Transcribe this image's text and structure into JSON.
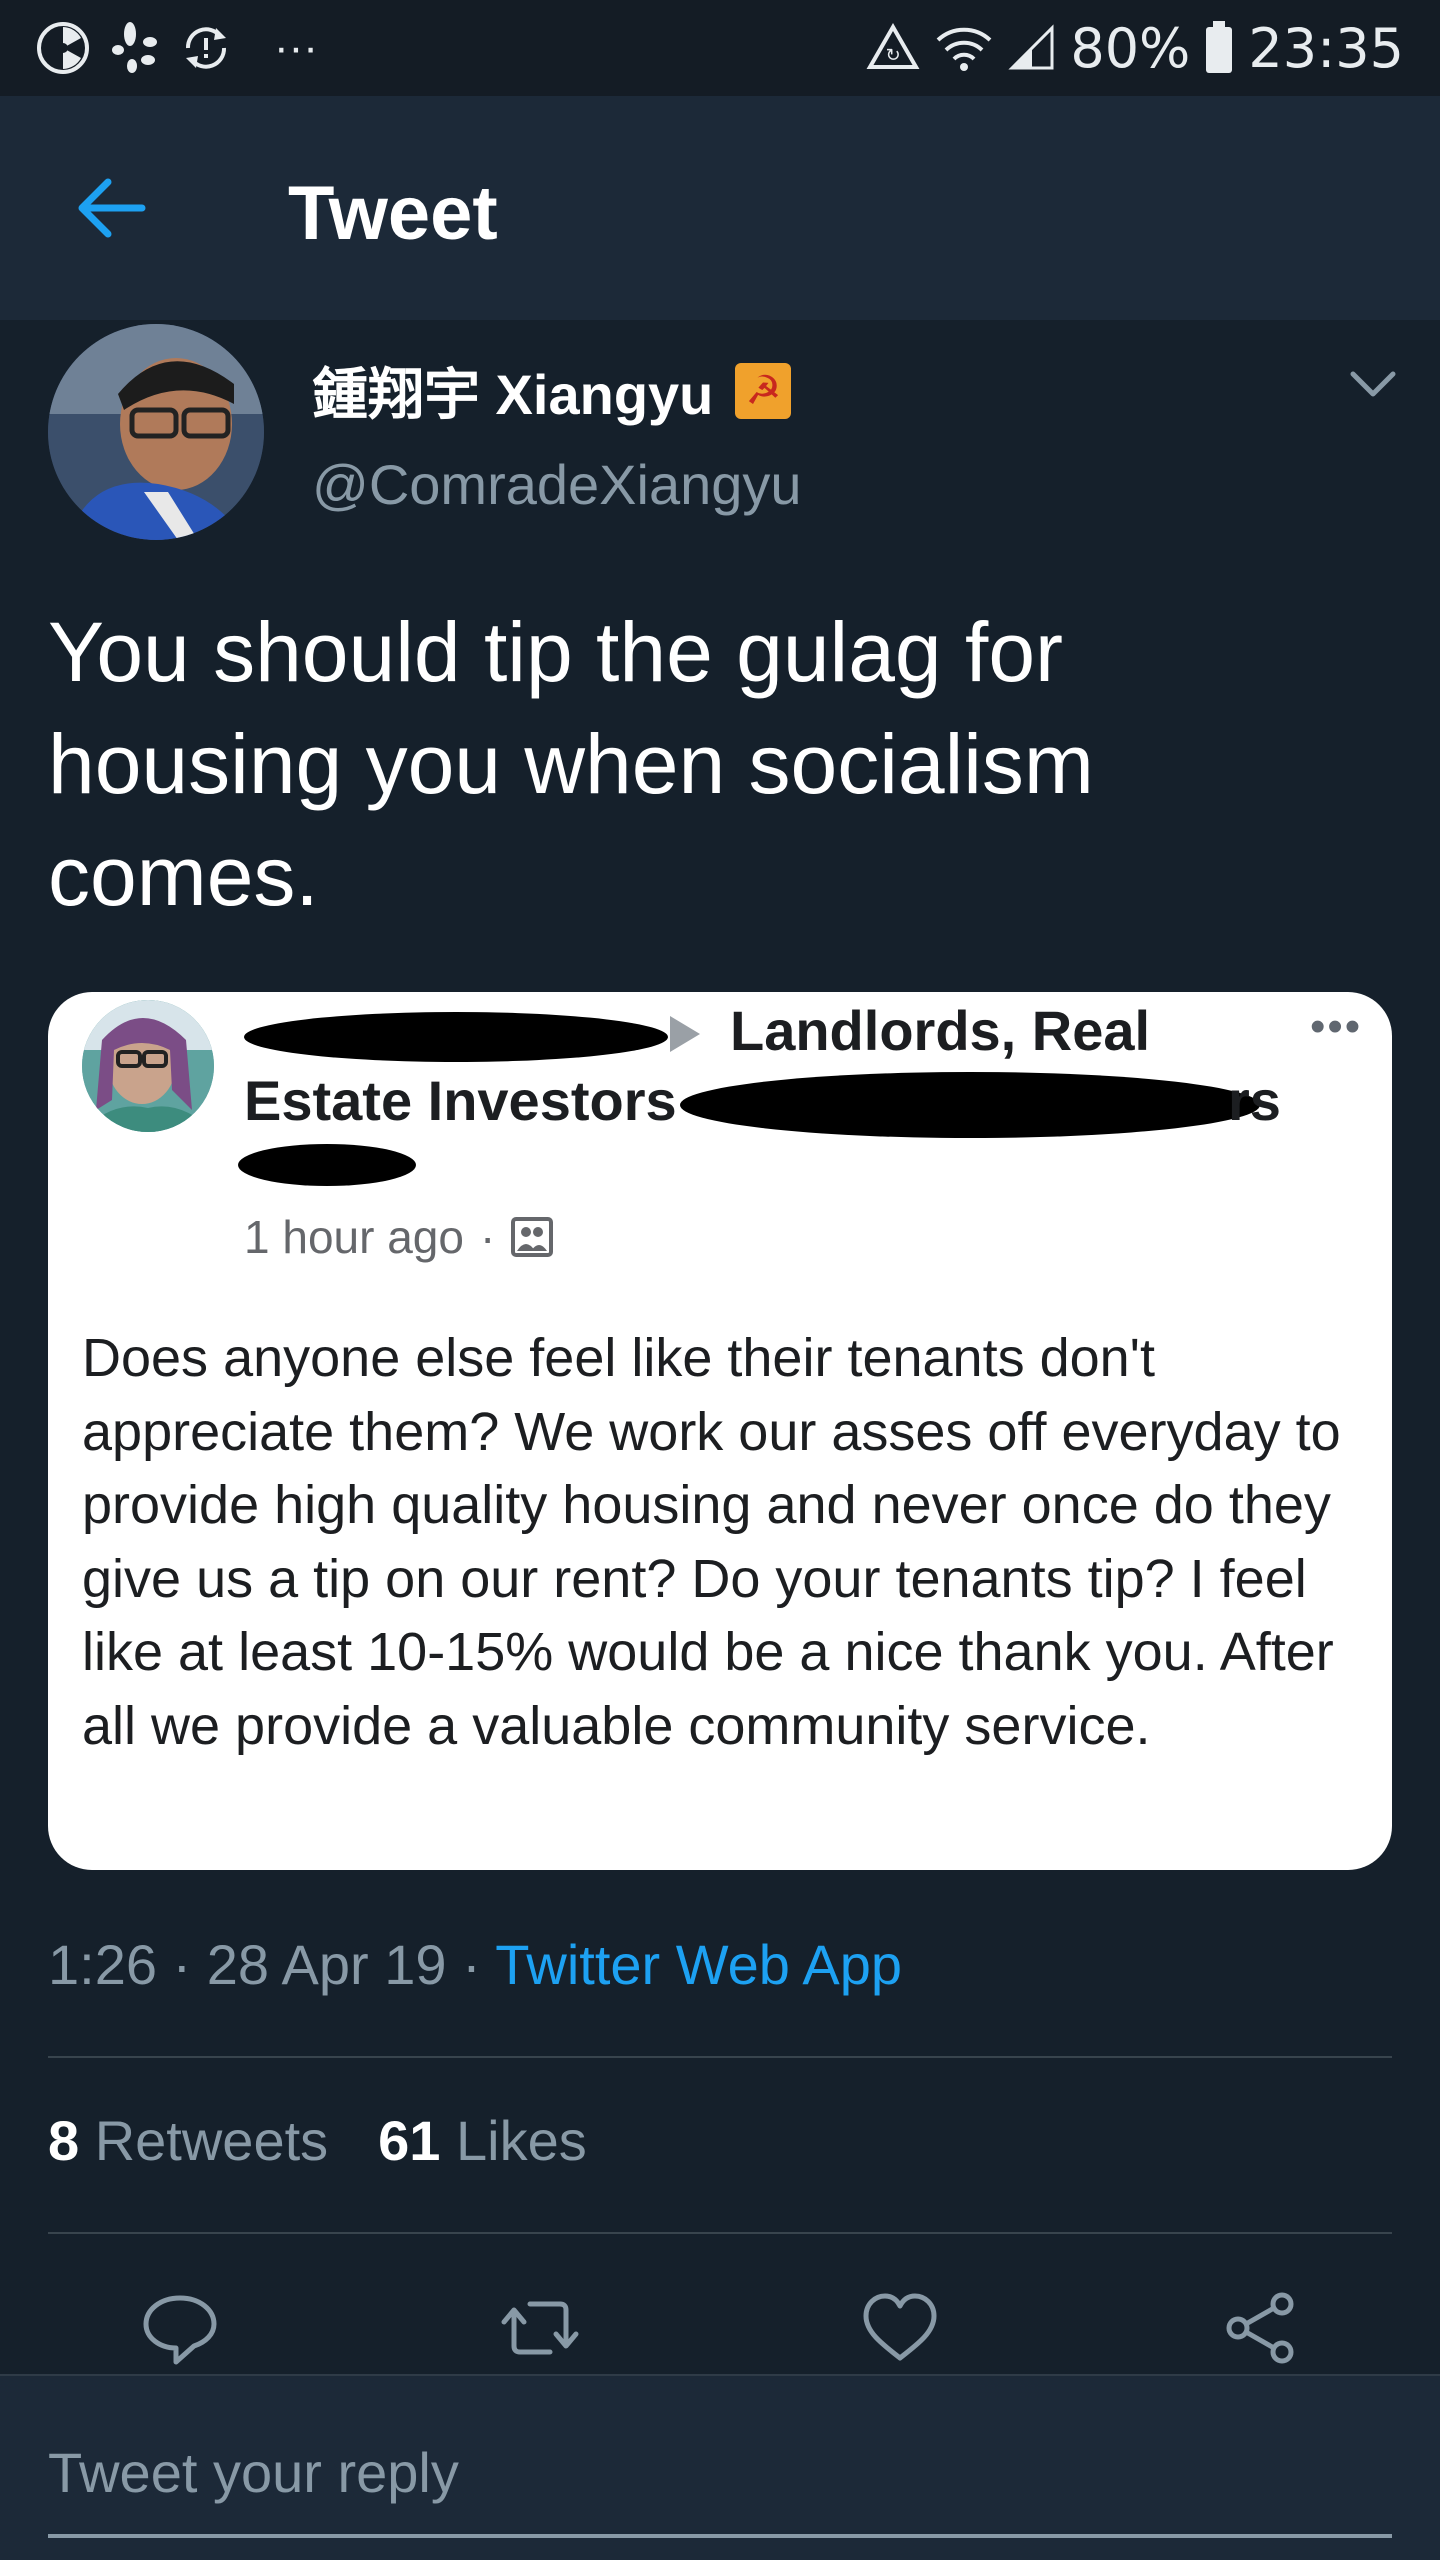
{
  "status_bar": {
    "more_dots": "···",
    "battery": "80%",
    "time": "23:35"
  },
  "header": {
    "title": "Tweet"
  },
  "author": {
    "display_name": "鍾翔宇 Xiangyu",
    "handle": "@ComradeXiangyu",
    "flag_glyph": "☭"
  },
  "tweet": {
    "text": "You should tip the gulag for housing you when socialism comes."
  },
  "embedded_post": {
    "group_name_line1": "Landlords, Real",
    "group_name_line2": "Estate Investors",
    "group_name_tail": "rs",
    "more_dots": "•••",
    "time": "1 hour ago",
    "separator": "·",
    "body": "Does anyone else feel like their tenants don't appreciate them? We work our asses off everyday to provide high quality housing and never once do they give us a tip on our rent? Do your tenants tip? I feel like at least 10-15% would be a nice thank you. After all we provide a valuable community service."
  },
  "meta": {
    "time": "1:26",
    "sep1": " · ",
    "date": "28 Apr 19",
    "sep2": " · ",
    "source": "Twitter Web App"
  },
  "stats": {
    "retweets_count": "8",
    "retweets_label": "Retweets",
    "likes_count": "61",
    "likes_label": "Likes"
  },
  "reply": {
    "placeholder": "Tweet your reply"
  },
  "colors": {
    "background": "#15202b",
    "header": "#1c2938",
    "accent": "#1da1f2",
    "secondary_text": "#8899a6"
  },
  "icons": {
    "back": "arrow-left-icon",
    "chevron": "chevron-down-icon",
    "reply": "comment-icon",
    "retweet": "retweet-icon",
    "like": "heart-icon",
    "share": "share-icon"
  }
}
